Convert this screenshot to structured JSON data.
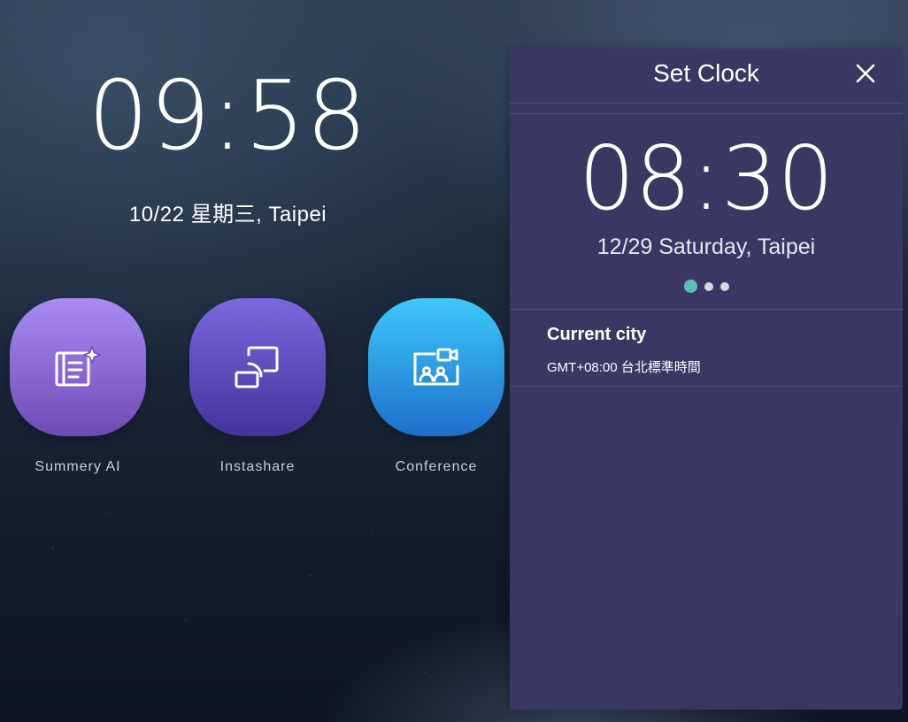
{
  "home": {
    "time": "09:58",
    "date": "10/22  星期三, Taipei"
  },
  "apps": [
    {
      "label": "Summery AI",
      "icon": "summary-ai-icon",
      "color_top": "#a98bf2",
      "color_bottom": "#6c4bb5"
    },
    {
      "label": "Instashare",
      "icon": "screen-cast-icon",
      "color_top": "#7b68e0",
      "color_bottom": "#44339a"
    },
    {
      "label": "Conference",
      "icon": "video-conference-icon",
      "color_top": "#3ec8fa",
      "color_bottom": "#1e6fcb"
    }
  ],
  "panel": {
    "title": "Set Clock",
    "close_icon": "close-icon",
    "time": "08:30",
    "date": "12/29  Saturday, Taipei",
    "page_count": 3,
    "active_page": 0,
    "accent": "#5fbfb6",
    "background": "#3a3862",
    "current_city": {
      "label": "Current city",
      "value": "GMT+08:00 台北標準時間"
    }
  }
}
